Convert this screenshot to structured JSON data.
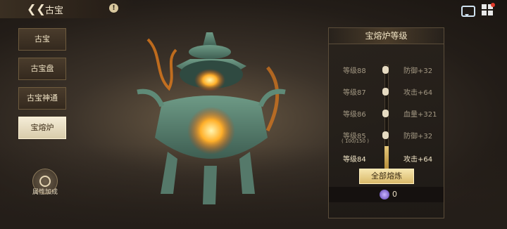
{
  "header": {
    "title": "古宝",
    "info": "!"
  },
  "menu": [
    {
      "label": "古宝",
      "active": false
    },
    {
      "label": "古宝盘",
      "active": false
    },
    {
      "label": "古宝神通",
      "active": false
    },
    {
      "label": "宝熔炉",
      "active": true
    }
  ],
  "attr_button": {
    "label": "属性加成"
  },
  "panel": {
    "title": "宝熔炉等级",
    "levels": [
      {
        "level": "等级88",
        "stat": "防御+32"
      },
      {
        "level": "等级87",
        "stat": "攻击+64"
      },
      {
        "level": "等级86",
        "stat": "血量+321"
      },
      {
        "level": "等级85",
        "stat": "防御+32"
      },
      {
        "level": "等级84",
        "stat": "攻击+64"
      }
    ],
    "progress_text": "( 100/150 )",
    "progress": 0.667,
    "melt_button": "全部熔炼",
    "cost_value": "0"
  },
  "colors": {
    "accent": "#d9b96a",
    "active_tab": "#f4ecd7"
  }
}
